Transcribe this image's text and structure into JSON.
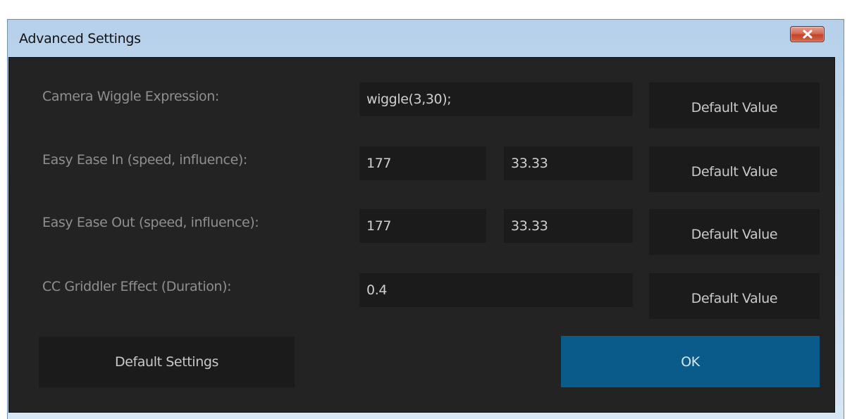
{
  "window": {
    "title": "Advanced Settings",
    "close_glyph": "close-icon"
  },
  "rows": [
    {
      "label": "Camera Wiggle Expression:",
      "values": [
        "wiggle(3,30);"
      ],
      "default_button": "Default Value"
    },
    {
      "label": "Easy Ease In (speed, influence):",
      "values": [
        "177",
        "33.33"
      ],
      "default_button": "Default Value"
    },
    {
      "label": "Easy Ease Out (speed, influence):",
      "values": [
        "177",
        "33.33"
      ],
      "default_button": "Default Value"
    },
    {
      "label": "CC Griddler Effect (Duration):",
      "values": [
        "0.4"
      ],
      "default_button": "Default Value"
    }
  ],
  "footer": {
    "default_settings_label": "Default Settings",
    "ok_label": "OK"
  },
  "colors": {
    "panel_bg": "#232323",
    "field_bg": "#1b1b1b",
    "ok_accent": "#0a5a8a",
    "close_red": "#c2442a"
  }
}
